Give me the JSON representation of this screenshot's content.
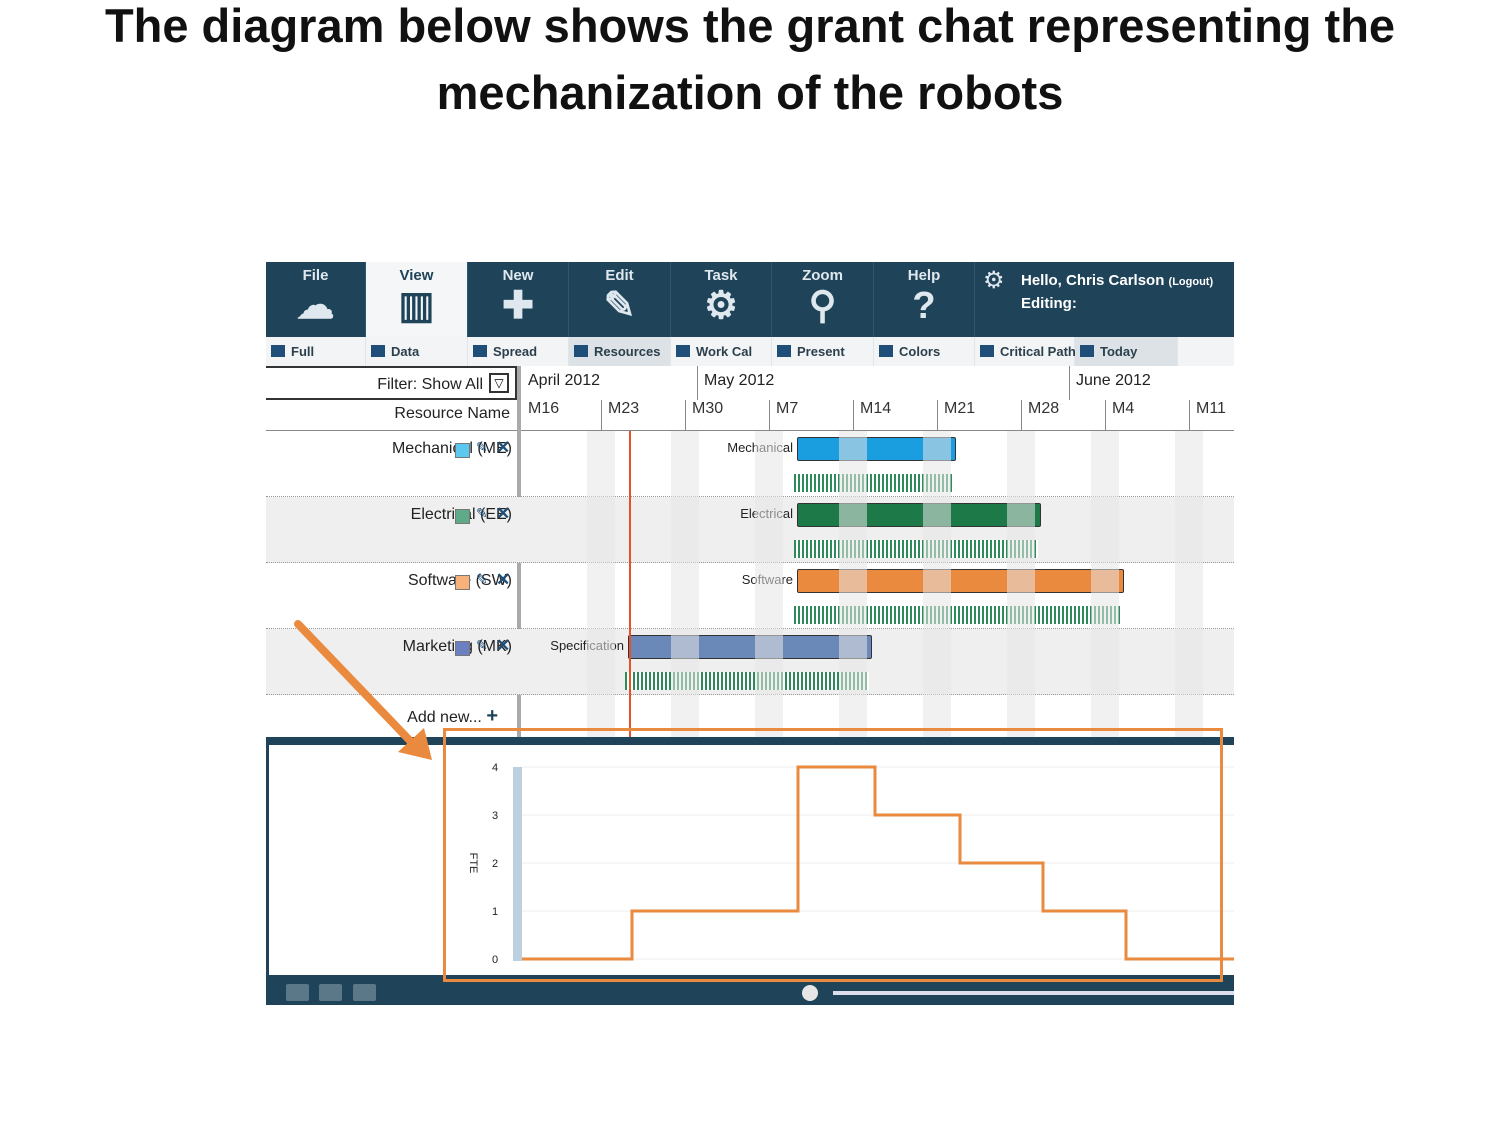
{
  "title": "The diagram below shows the grant chat representing the mechanization of the robots",
  "toolbar": {
    "buttons": [
      {
        "label": "File",
        "icon": "cloud-icon"
      },
      {
        "label": "View",
        "icon": "columns-icon",
        "active": true
      },
      {
        "label": "New",
        "icon": "plus-icon"
      },
      {
        "label": "Edit",
        "icon": "pencil-icon"
      },
      {
        "label": "Task",
        "icon": "gear-ticket-icon"
      },
      {
        "label": "Zoom",
        "icon": "magnifier-icon"
      },
      {
        "label": "Help",
        "icon": "question-icon"
      }
    ],
    "sub": [
      {
        "label": "Full"
      },
      {
        "label": "Data"
      },
      {
        "label": "Spread"
      },
      {
        "label": "Resources",
        "highlighted": true
      },
      {
        "label": "Work Cal"
      },
      {
        "label": "Present"
      },
      {
        "label": "Colors"
      },
      {
        "label": "Critical Path"
      },
      {
        "label": "Today",
        "highlighted": true
      }
    ],
    "greeting": "Hello, Chris Carlson",
    "logout": "(Logout)",
    "editing": "Editing:"
  },
  "grid": {
    "filter": "Filter: Show All",
    "resource_header": "Resource Name",
    "months": [
      "April 2012",
      "May 2012",
      "June 2012"
    ],
    "weeks": [
      "M16",
      "M23",
      "M30",
      "M7",
      "M14",
      "M21",
      "M28",
      "M4",
      "M11"
    ],
    "add_new": "Add new..."
  },
  "resources": [
    {
      "name": "Mechanical  (ME)",
      "color": "#5bc8f0",
      "bar_label": "Mechanical",
      "bar_color": "#1a9ee0"
    },
    {
      "name": "Electrical (EE)",
      "color": "#5faa88",
      "bar_label": "Electrical",
      "bar_color": "#1d7a48"
    },
    {
      "name": "Software (SW)",
      "color": "#f7b27a",
      "bar_label": "Software",
      "bar_color": "#ea8a3e"
    },
    {
      "name": "Marketing (MK)",
      "color": "#6a80c0",
      "bar_label": "Specification",
      "bar_color": "#6a88b8"
    }
  ],
  "chart_data": {
    "type": "line",
    "step": true,
    "ylabel": "FTE",
    "yticks": [
      0,
      1,
      2,
      3,
      4
    ],
    "ylim": [
      0,
      4
    ],
    "values": [
      0,
      1,
      4,
      3,
      2,
      1,
      0
    ],
    "color": "#ea8a3e",
    "grid": true
  },
  "colors": {
    "toolbar": "#1f4358",
    "highlight": "#ea8a3e",
    "today_line": "#e8502a"
  }
}
